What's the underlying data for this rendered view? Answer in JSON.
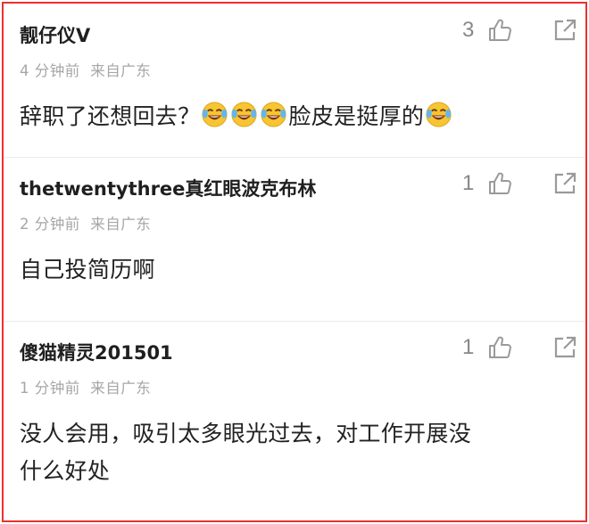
{
  "comments": [
    {
      "username": "靓仔仪V",
      "time": "4 分钟前",
      "location": "来自广东",
      "likes": "3",
      "text_part1": "辞职了还想回去？",
      "text_part2": "脸皮是挺厚的",
      "emoji": "laughing-tears-icon"
    },
    {
      "username": "thetwentythree真红眼波克布林",
      "time": "2 分钟前",
      "location": "来自广东",
      "likes": "1",
      "text": "自己投简历啊"
    },
    {
      "username": "傻猫精灵201501",
      "time": "1 分钟前",
      "location": "来自广东",
      "likes": "1",
      "text_line1": "没人会用，吸引太多眼光过去，对工作开展没",
      "text_line2": "什么好处"
    }
  ],
  "colors": {
    "border": "#e8322f",
    "meta": "#a6a6a6",
    "icon": "#9a9a9a"
  }
}
